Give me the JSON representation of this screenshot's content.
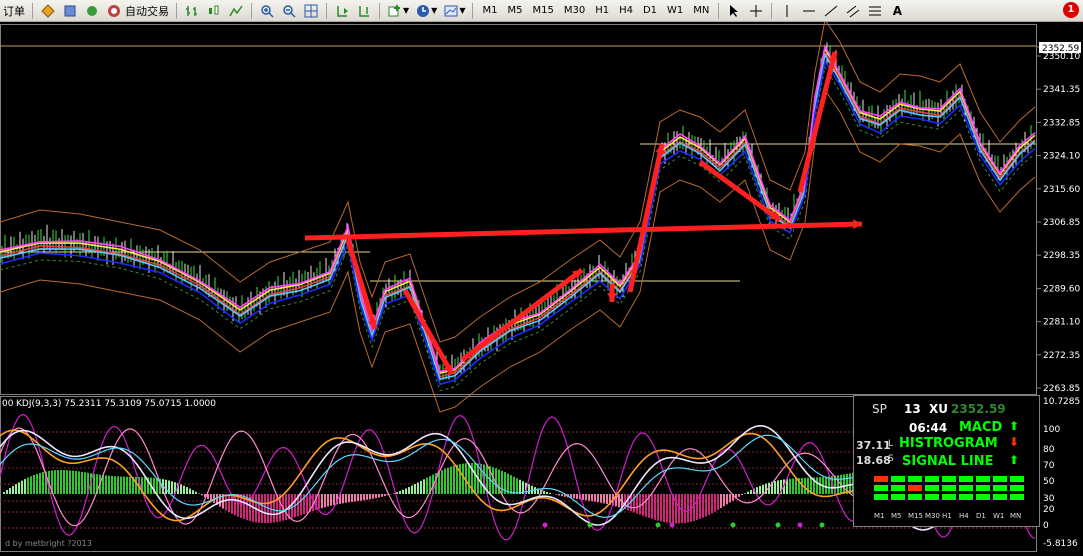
{
  "toolbar": {
    "order_label": "订单",
    "autotrade_label": "自动交易",
    "timeframes": [
      "M1",
      "M5",
      "M15",
      "M30",
      "H1",
      "H4",
      "D1",
      "W1",
      "MN"
    ],
    "notification_count": "1"
  },
  "main_chart": {
    "price_labels": [
      "2352.59",
      "2350.10",
      "2341.35",
      "2332.85",
      "2324.10",
      "2315.60",
      "2306.85",
      "2298.35",
      "2289.60",
      "2281.10",
      "2272.35",
      "2263.85"
    ],
    "current_price": "2352.59"
  },
  "sub_chart": {
    "indicator_label": "KDJ(9,3,3) 75.2311 75.3109 75.0715 1.0000",
    "prefix": "00",
    "axis_labels": [
      "10.7285",
      "100",
      "80",
      "70",
      "50",
      "30",
      "20",
      "0",
      "-5.8136"
    ],
    "copyright": "d by metbright ?2013"
  },
  "info_panel": {
    "symbol": "SP",
    "spread": "13",
    "pair": "XU",
    "price": "2352.59",
    "time": "06:44",
    "macd_label": "MACD",
    "histogram_label": "HISTROGRAM",
    "signal_label": "SIGNAL LINE",
    "value1": "37.11",
    "value2": "18.68",
    "l_letter": "L",
    "s_letter": "S",
    "timeframes": [
      "M1",
      "M5",
      "M15",
      "M30",
      "H1",
      "H4",
      "D1",
      "W1",
      "MN"
    ],
    "colors": {
      "up": "#00ff00",
      "down": "#ff3300",
      "label": "#00ff00"
    }
  }
}
